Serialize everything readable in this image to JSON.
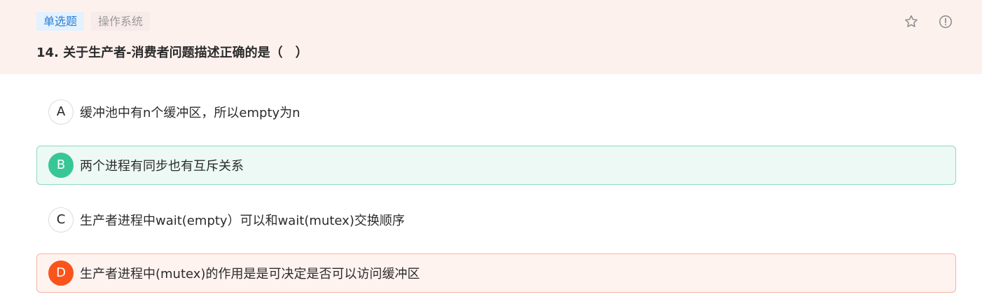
{
  "header": {
    "type_tag": "单选题",
    "subject_tag": "操作系统",
    "question": "14. 关于生产者-消费者问题描述正确的是（　）",
    "icons": [
      "star-icon",
      "info-icon"
    ]
  },
  "options": [
    {
      "letter": "A",
      "text": "缓冲池中有n个缓冲区，所以empty为n",
      "state": "normal"
    },
    {
      "letter": "B",
      "text": "两个进程有同步也有互斥关系",
      "state": "correct"
    },
    {
      "letter": "C",
      "text": "生产者进程中wait(empty）可以和wait(mutex)交换顺序",
      "state": "normal"
    },
    {
      "letter": "D",
      "text": "生产者进程中(mutex)的作用是是可决定是否可以访问缓冲区",
      "state": "wrong"
    }
  ],
  "colors": {
    "header_bg": "#fdf1ee",
    "correct": "#37c796",
    "wrong": "#fa541c",
    "tag_blue": "#2a7fd4"
  }
}
